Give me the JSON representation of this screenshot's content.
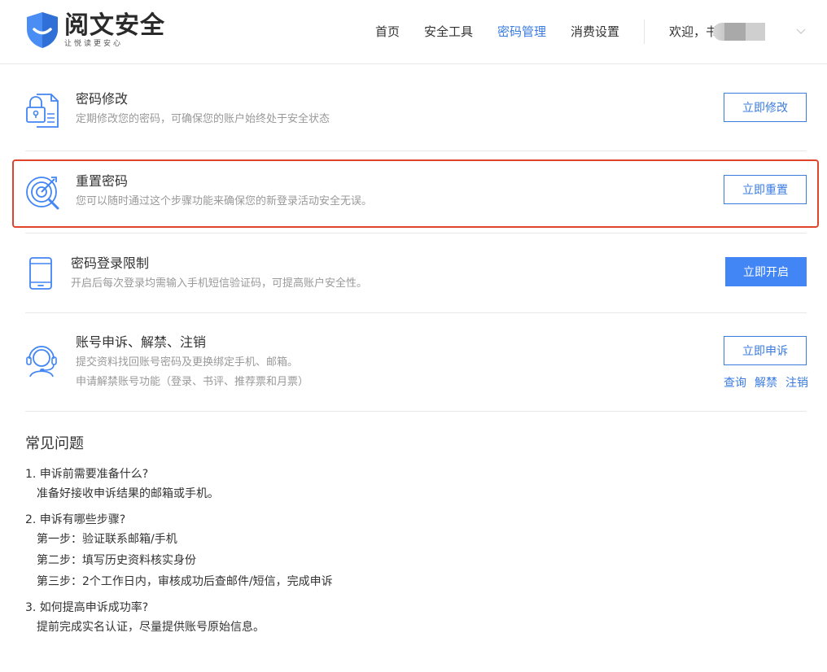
{
  "header": {
    "logo_title": "阅文安全",
    "logo_subtitle": "让悦读更安心",
    "nav": [
      {
        "label": "首页",
        "active": false
      },
      {
        "label": "安全工具",
        "active": false
      },
      {
        "label": "密码管理",
        "active": true
      },
      {
        "label": "消费设置",
        "active": false
      }
    ],
    "welcome": "欢迎，书"
  },
  "rows": [
    {
      "title": "密码修改",
      "desc": "定期修改您的密码，可确保您的账户始终处于安全状态",
      "button": "立即修改",
      "icon": "lock-document-icon"
    },
    {
      "title": "重置密码",
      "desc": "您可以随时通过这个步骤功能来确保您的新登录活动安全无误。",
      "button": "立即重置",
      "icon": "target-reset-icon"
    },
    {
      "title": "密码登录限制",
      "desc": "开启后每次登录均需输入手机短信验证码，可提高账户安全性。",
      "button": "立即开启",
      "icon": "phone-icon"
    },
    {
      "title": "账号申诉、解禁、注销",
      "desc": "提交资料找回账号密码及更换绑定手机、邮箱。",
      "desc2": "申请解禁账号功能（登录、书评、推荐票和月票）",
      "button": "立即申诉",
      "links": [
        "查询",
        "解禁",
        "注销"
      ],
      "icon": "customer-service-icon"
    }
  ],
  "faq": {
    "title": "常见问题",
    "items": [
      {
        "q": "1. 申诉前需要准备什么?",
        "a": [
          "准备好接收申诉结果的邮箱或手机。"
        ]
      },
      {
        "q": "2. 申诉有哪些步骤?",
        "a": [
          "第一步：验证联系邮箱/手机",
          "第二步：填写历史资料核实身份",
          "第三步：2个工作日内，审核成功后查邮件/短信，完成申诉"
        ]
      },
      {
        "q": "3. 如何提高申诉成功率?",
        "a": [
          "提前完成实名认证，尽量提供账号原始信息。"
        ]
      }
    ]
  },
  "colors": {
    "accent": "#3a7be0",
    "primary_button": "#4285f4",
    "highlight": "#e0442c"
  }
}
